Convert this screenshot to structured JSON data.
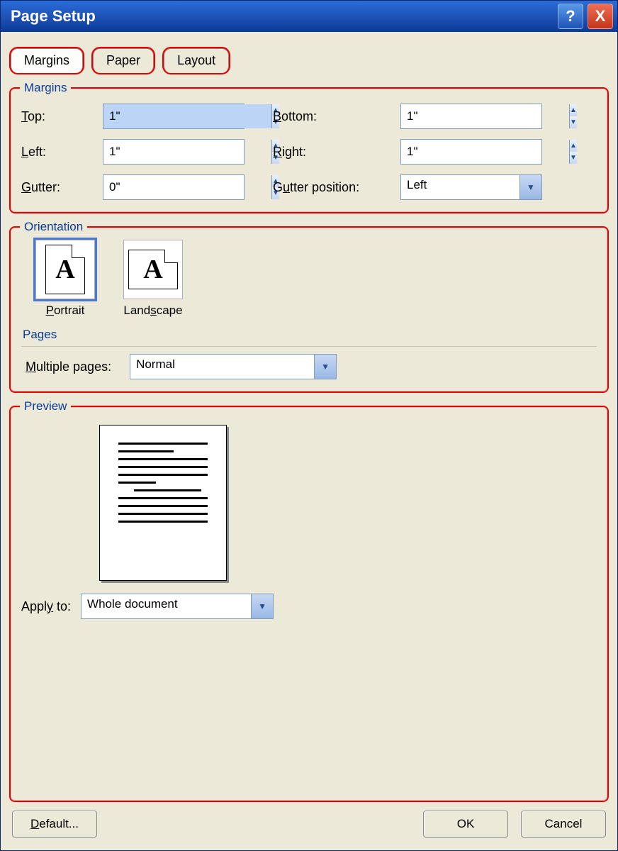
{
  "window": {
    "title": "Page Setup"
  },
  "tabs": {
    "margins": "Margins",
    "paper": "Paper",
    "layout": "Layout"
  },
  "groups": {
    "margins": "Margins",
    "orientation": "Orientation",
    "pages": "Pages",
    "preview": "Preview"
  },
  "margin_fields": {
    "top": {
      "label": "Top:",
      "value": "1\""
    },
    "bottom": {
      "label": "Bottom:",
      "value": "1\""
    },
    "left": {
      "label": "Left:",
      "value": "1\""
    },
    "right": {
      "label": "Right:",
      "value": "1\""
    },
    "gutter": {
      "label": "Gutter:",
      "value": "0\""
    },
    "gutter_pos": {
      "label": "Gutter position:",
      "value": "Left"
    }
  },
  "orientation": {
    "portrait": {
      "label": "Portrait",
      "selected": true
    },
    "landscape": {
      "label": "Landscape",
      "selected": false
    }
  },
  "pages": {
    "multiple_label": "Multiple pages:",
    "multiple_value": "Normal"
  },
  "preview": {
    "apply_label": "Apply to:",
    "apply_value": "Whole document"
  },
  "buttons": {
    "default": "Default...",
    "ok": "OK",
    "cancel": "Cancel"
  },
  "title_icons": {
    "help": "?",
    "close": "X"
  }
}
